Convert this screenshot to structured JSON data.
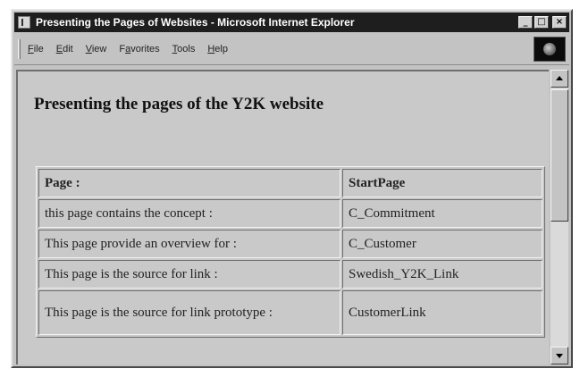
{
  "window": {
    "title": "Presenting the Pages of Websites - Microsoft Internet Explorer",
    "buttons": {
      "minimize": "_",
      "maximize": "□",
      "close": "×"
    }
  },
  "menu": {
    "items": [
      {
        "mnemonic": "F",
        "rest": "ile"
      },
      {
        "mnemonic": "E",
        "rest": "dit"
      },
      {
        "mnemonic": "V",
        "rest": "iew"
      },
      {
        "prefix": "F",
        "mnemonic": "a",
        "rest": "vorites"
      },
      {
        "mnemonic": "T",
        "rest": "ools"
      },
      {
        "mnemonic": "H",
        "rest": "elp"
      }
    ]
  },
  "page": {
    "heading": "Presenting the pages of the Y2K website",
    "table": {
      "headers": [
        "Page :",
        "StartPage"
      ],
      "rows": [
        [
          "this page contains the concept :",
          "C_Commitment"
        ],
        [
          "This page provide an overview for :",
          "C_Customer"
        ],
        [
          "This page is the source for link :",
          "Swedish_Y2K_Link"
        ],
        [
          "This page is the source for link prototype :",
          "CustomerLink"
        ]
      ]
    }
  }
}
